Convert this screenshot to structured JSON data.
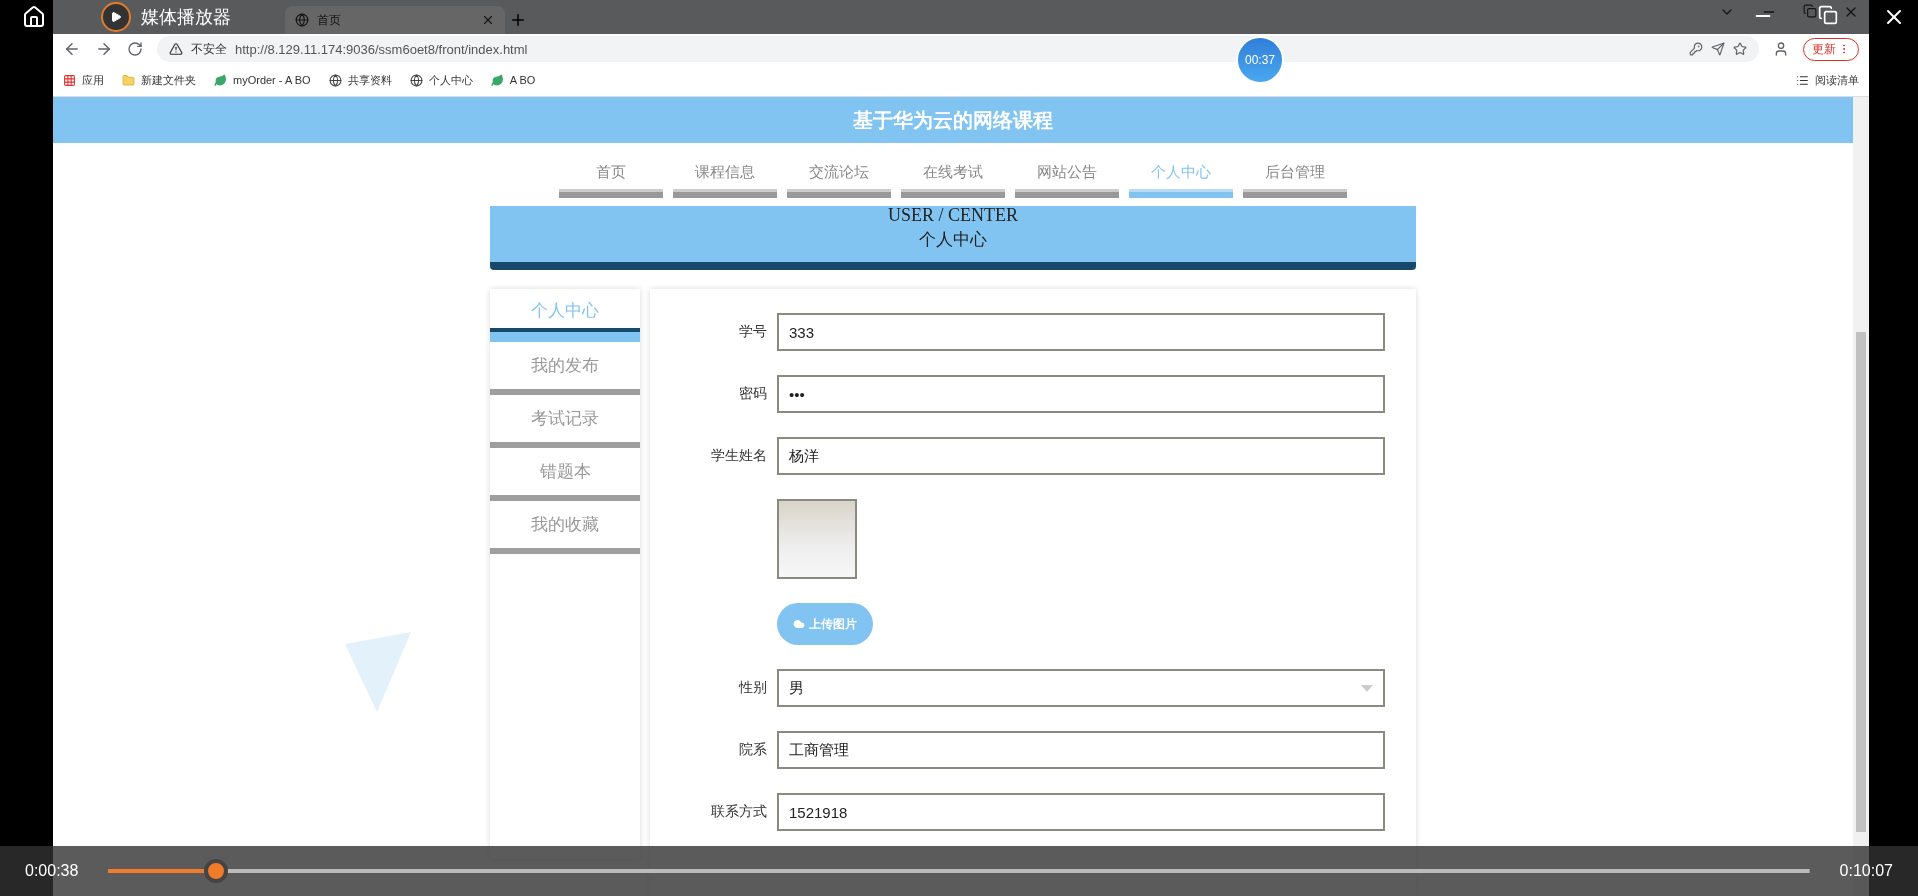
{
  "player": {
    "title": "媒体播放器",
    "elapsed": "0:00:38",
    "duration": "0:10:07",
    "level": 0.063,
    "seek_bubble": "00:37"
  },
  "browser": {
    "tabs": [
      {
        "label": "首页",
        "selected": true
      }
    ],
    "address": {
      "warning": "不安全",
      "url": "http://8.129.11.174:9036/ssm6oet8/front/index.html"
    },
    "update_button": "更新",
    "bookmarks": [
      {
        "label": "应用",
        "kind": "apps"
      },
      {
        "label": "新建文件夹",
        "kind": "folder"
      },
      {
        "label": "myOrder - A BO",
        "kind": "site"
      },
      {
        "label": "共享资料",
        "kind": "globe"
      },
      {
        "label": "个人中心",
        "kind": "globe"
      },
      {
        "label": "A BO",
        "kind": "site"
      }
    ],
    "reading_list": "阅读清单"
  },
  "site": {
    "title": "基于华为云的网络课程",
    "nav": [
      {
        "label": "首页",
        "selected": false
      },
      {
        "label": "课程信息",
        "selected": false
      },
      {
        "label": "交流论坛",
        "selected": false
      },
      {
        "label": "在线考试",
        "selected": false
      },
      {
        "label": "网站公告",
        "selected": false
      },
      {
        "label": "个人中心",
        "selected": true
      },
      {
        "label": "后台管理",
        "selected": false
      }
    ],
    "banner": {
      "en": "USER / CENTER",
      "zh": "个人中心"
    },
    "sidebar": [
      {
        "label": "个人中心",
        "selected": true
      },
      {
        "label": "我的发布",
        "selected": false
      },
      {
        "label": "考试记录",
        "selected": false
      },
      {
        "label": "错题本",
        "selected": false
      },
      {
        "label": "我的收藏",
        "selected": false
      }
    ],
    "form": [
      {
        "kind": "text",
        "label": "学号",
        "value": "333"
      },
      {
        "kind": "password",
        "label": "密码",
        "value": "•••"
      },
      {
        "kind": "text",
        "label": "学生姓名",
        "value": "杨洋"
      },
      {
        "kind": "image"
      },
      {
        "kind": "upload",
        "label": "上传图片"
      },
      {
        "kind": "select",
        "label": "性别",
        "value": "男"
      },
      {
        "kind": "text",
        "label": "院系",
        "value": "工商管理"
      },
      {
        "kind": "text",
        "label": "联系方式",
        "value": "1521918"
      }
    ]
  }
}
